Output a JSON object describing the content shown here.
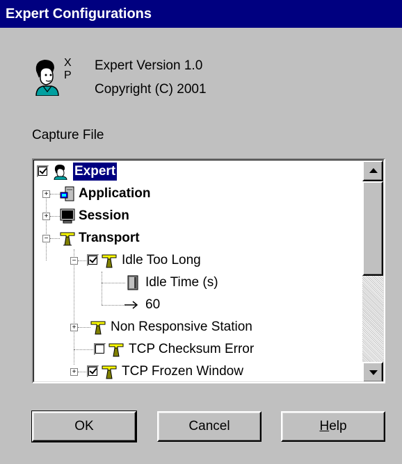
{
  "window": {
    "title": "Expert Configurations"
  },
  "about": {
    "xp_top": "X",
    "xp_bottom": "P",
    "version": "Expert Version 1.0",
    "copyright": "Copyright (C) 2001"
  },
  "capture_label": "Capture File",
  "tree": {
    "items": [
      {
        "label": "Expert",
        "bold": true,
        "selected": true,
        "checkbox": "checked",
        "icon": "expert-person-icon"
      },
      {
        "label": "Application",
        "bold": true,
        "expander": "+",
        "icon": "application-icon"
      },
      {
        "label": "Session",
        "bold": true,
        "expander": "+",
        "icon": "session-monitor-icon"
      },
      {
        "label": "Transport",
        "bold": true,
        "expander": "-",
        "icon": "transport-antenna-icon"
      },
      {
        "label": "Idle Too Long",
        "expander": "-",
        "checkbox": "checked",
        "icon": "transport-antenna-icon"
      },
      {
        "label": "Idle Time (s)",
        "icon": "parameter-icon"
      },
      {
        "label": "60",
        "icon": "arrow-right-icon"
      },
      {
        "label": "Non Responsive Station",
        "expander": "+",
        "icon": "transport-antenna-icon"
      },
      {
        "label": "TCP Checksum Error",
        "checkbox": "unchecked",
        "icon": "transport-antenna-icon"
      },
      {
        "label": "TCP Frozen Window",
        "expander": "+",
        "checkbox": "checked",
        "icon": "transport-antenna-icon"
      }
    ]
  },
  "buttons": {
    "ok": "OK",
    "cancel": "Cancel",
    "help_mnemonic": "H",
    "help_rest": "elp"
  },
  "colors": {
    "titlebar": "#000080",
    "face": "#c0c0c0",
    "selection": "#000080"
  }
}
